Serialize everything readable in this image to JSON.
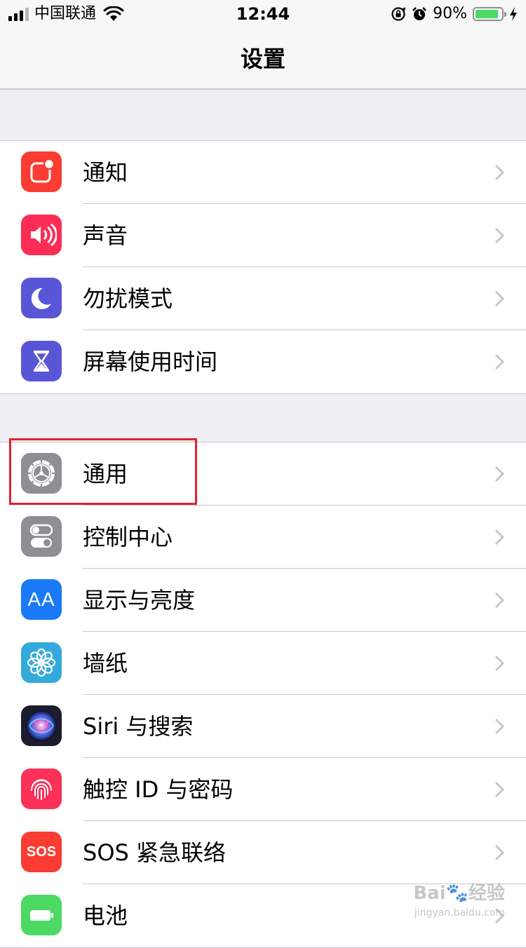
{
  "status_bar": {
    "carrier": "中国联通",
    "time": "12:44",
    "battery_percent": "90%",
    "battery_level": 0.9
  },
  "nav": {
    "title": "设置"
  },
  "groups": [
    {
      "items": [
        {
          "label": "通知",
          "icon": "notifications-icon",
          "color": "#fb3c32"
        },
        {
          "label": "声音",
          "icon": "sounds-icon",
          "color": "#fc2d55"
        },
        {
          "label": "勿扰模式",
          "icon": "do-not-disturb-icon",
          "color": "#5856d6"
        },
        {
          "label": "屏幕使用时间",
          "icon": "screen-time-icon",
          "color": "#5856d6"
        }
      ]
    },
    {
      "items": [
        {
          "label": "通用",
          "icon": "general-gear-icon",
          "color": "#8e8e93"
        },
        {
          "label": "控制中心",
          "icon": "control-center-icon",
          "color": "#8e8e93"
        },
        {
          "label": "显示与亮度",
          "icon": "display-brightness-icon",
          "color": "#1a7af8"
        },
        {
          "label": "墙纸",
          "icon": "wallpaper-icon",
          "color": "#34aadc"
        },
        {
          "label": "Siri 与搜索",
          "icon": "siri-icon",
          "color": "#1c1c2e"
        },
        {
          "label": "触控 ID 与密码",
          "icon": "touch-id-icon",
          "color": "#fc3158"
        },
        {
          "label": "SOS 紧急联络",
          "icon": "sos-icon",
          "color": "#fb3c32"
        },
        {
          "label": "电池",
          "icon": "battery-icon",
          "color": "#4cd964"
        }
      ]
    }
  ],
  "icon_texts": {
    "display": "AA",
    "sos": "SOS"
  },
  "watermark": {
    "brand": "Bai🐾经验",
    "url": "jingyan.baidu.com"
  }
}
